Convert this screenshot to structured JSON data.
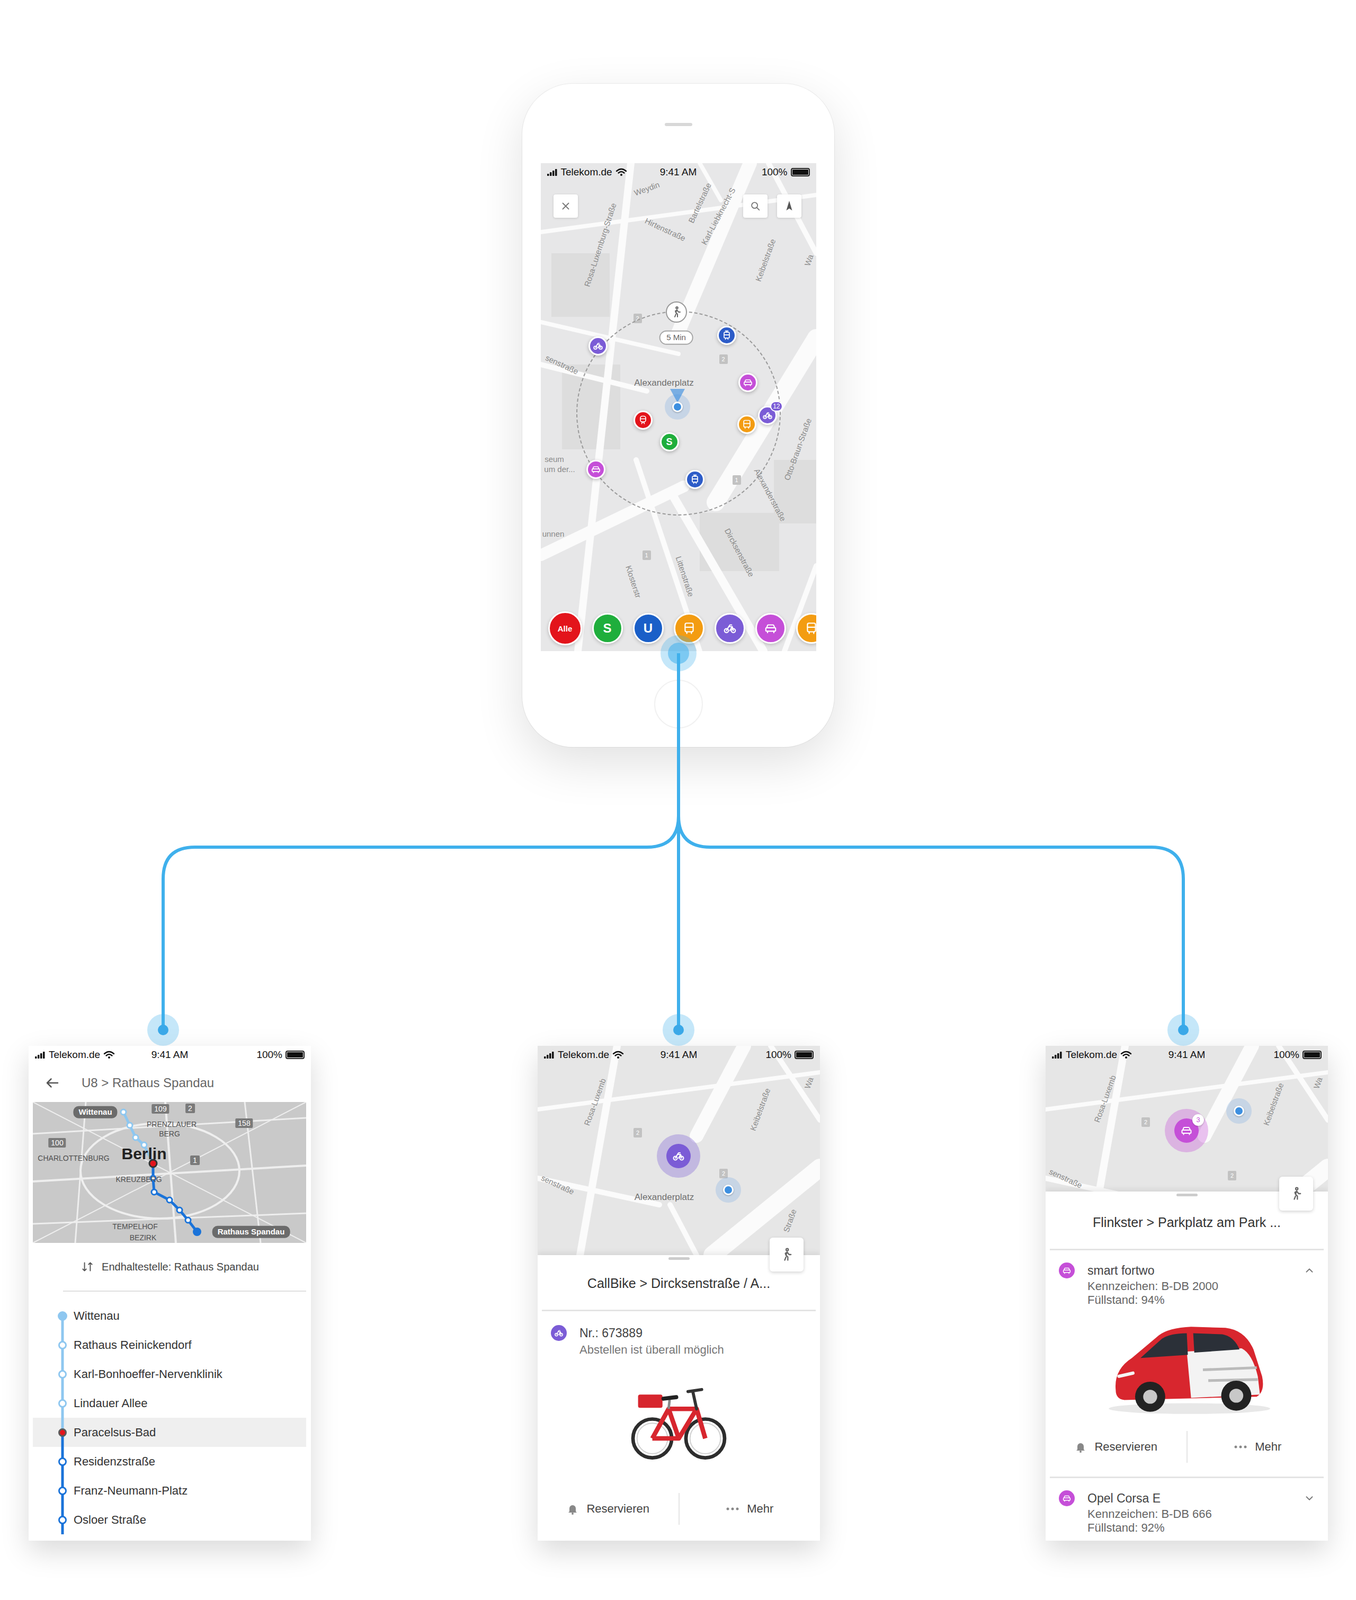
{
  "main_screen": {
    "status_bar": {
      "carrier": "Telekom.de",
      "time": "9:41 AM",
      "battery": "100%",
      "battery_level": 1
    },
    "map": {
      "streets": [
        "Weydin",
        "Bartelstraße",
        "Karl-Liebknecht-S",
        "Hirtenstraße",
        "Rosa-Luxemburg-Straße",
        "Keibelstraße",
        "Wa",
        "senstraße",
        "Otto-Braun-Straße",
        "Alexanderstraße",
        "Dircksenstraße",
        "Littenstraße",
        "Klosterstr",
        "seum",
        "um der...",
        "unnen"
      ],
      "markers": [
        "2",
        "2",
        "1",
        "1"
      ],
      "place": "Alexanderplatz",
      "walk_time": "5 Min",
      "pins": [
        {
          "kind": "bike",
          "color": "#7b5cd6"
        },
        {
          "kind": "tram",
          "color": "#2d5cc8"
        },
        {
          "kind": "car",
          "color": "#c54fd8"
        },
        {
          "kind": "bike",
          "color": "#7b5cd6",
          "count": "12"
        },
        {
          "kind": "bus",
          "color": "#f39c12"
        },
        {
          "kind": "train",
          "color": "#e3141b"
        },
        {
          "kind": "letter",
          "label": "S",
          "color": "#1fae3c"
        },
        {
          "kind": "car",
          "color": "#c54fd8"
        },
        {
          "kind": "tram",
          "color": "#2d5cc8"
        }
      ]
    },
    "filters": [
      {
        "kind": "letter",
        "label": "Alle",
        "selected": true,
        "color": "#e3141b"
      },
      {
        "kind": "letter",
        "label": "S",
        "selected": false,
        "color": "#1fae3c"
      },
      {
        "kind": "letter",
        "label": "U",
        "selected": false,
        "color": "#1a5fc8"
      },
      {
        "kind": "bus",
        "selected": false,
        "color": "#f39c12"
      },
      {
        "kind": "bike",
        "selected": false,
        "color": "#7b5cd6"
      },
      {
        "kind": "car",
        "selected": false,
        "color": "#c54fd8"
      },
      {
        "kind": "bus",
        "selected": false,
        "color": "#f39c12"
      }
    ]
  },
  "line_screen": {
    "status_bar": {
      "carrier": "Telekom.de",
      "time": "9:41 AM",
      "battery": "100%",
      "battery_level": 1
    },
    "title": "U8 > Rathaus Spandau",
    "map": {
      "city": "Berlin",
      "tags": [
        "Wittenau",
        "Rathaus Spandau"
      ],
      "road_numbers": [
        "109",
        "2",
        "158",
        "100",
        "1"
      ],
      "districts": [
        "PRENZLAUER",
        "BERG",
        "CHARLOTTENBURG",
        "KREUZBERG",
        "TEMPELHOF",
        "BEZIRK"
      ]
    },
    "destination": "Endhaltestelle: Rathaus Spandau",
    "stops": [
      {
        "name": "Wittenau",
        "terminus": true,
        "passed": true,
        "selected": false
      },
      {
        "name": "Rathaus Reinickendorf",
        "terminus": false,
        "passed": true,
        "selected": false
      },
      {
        "name": "Karl-Bonhoeffer-Nervenklinik",
        "terminus": false,
        "passed": true,
        "selected": false
      },
      {
        "name": "Lindauer Allee",
        "terminus": false,
        "passed": true,
        "selected": false
      },
      {
        "name": "Paracelsus-Bad",
        "terminus": false,
        "passed": false,
        "selected": true
      },
      {
        "name": "Residenzstraße",
        "terminus": false,
        "passed": false,
        "selected": false
      },
      {
        "name": "Franz-Neumann-Platz",
        "terminus": false,
        "passed": false,
        "selected": false
      },
      {
        "name": "Osloer Straße",
        "terminus": false,
        "passed": false,
        "selected": false
      }
    ]
  },
  "bike_screen": {
    "status_bar": {
      "carrier": "Telekom.de",
      "time": "9:41 AM",
      "battery": "100%",
      "battery_level": 1
    },
    "map": {
      "streets": [
        "Rosa-Luxemb",
        "Keibelstraße",
        "Wa",
        "senstraße",
        "Straße"
      ],
      "markers": [
        "2",
        "2"
      ],
      "place": "Alexanderplatz",
      "pin": {
        "kind": "bike",
        "color": "#7b5cd6"
      }
    },
    "title": "CallBike > Dircksenstraße / A...",
    "bike": {
      "kind": "bike",
      "color": "#7b5cd6",
      "number": "Nr.: 673889",
      "note": "Abstellen ist überall möglich"
    },
    "actions": [
      {
        "kind": "reserve",
        "label": "Reservieren"
      },
      {
        "kind": "more",
        "label": "Mehr"
      }
    ]
  },
  "car_screen": {
    "status_bar": {
      "carrier": "Telekom.de",
      "time": "9:41 AM",
      "battery": "100%",
      "battery_level": 1
    },
    "map": {
      "streets": [
        "Rosa-Luxemb",
        "Keibelstraße",
        "Wa",
        "senstraße"
      ],
      "markers": [
        "2",
        "2"
      ],
      "pin": {
        "kind": "car",
        "color": "#c54fd8",
        "count": "3"
      }
    },
    "title": "Flinkster > Parkplatz am Park ...",
    "vehicles": [
      {
        "kind": "car",
        "color": "#c54fd8",
        "name": "smart fortwo",
        "plate": "Kennzeichen: B-DB 2000",
        "fuel": "Füllstand: 94%",
        "expanded": true
      },
      {
        "kind": "car",
        "color": "#c54fd8",
        "name": "Opel Corsa E",
        "plate": "Kennzeichen: B-DB 666",
        "fuel": "Füllstand: 92%",
        "expanded": false
      }
    ],
    "actions": [
      {
        "kind": "reserve",
        "label": "Reservieren"
      },
      {
        "kind": "more",
        "label": "Mehr"
      }
    ]
  }
}
